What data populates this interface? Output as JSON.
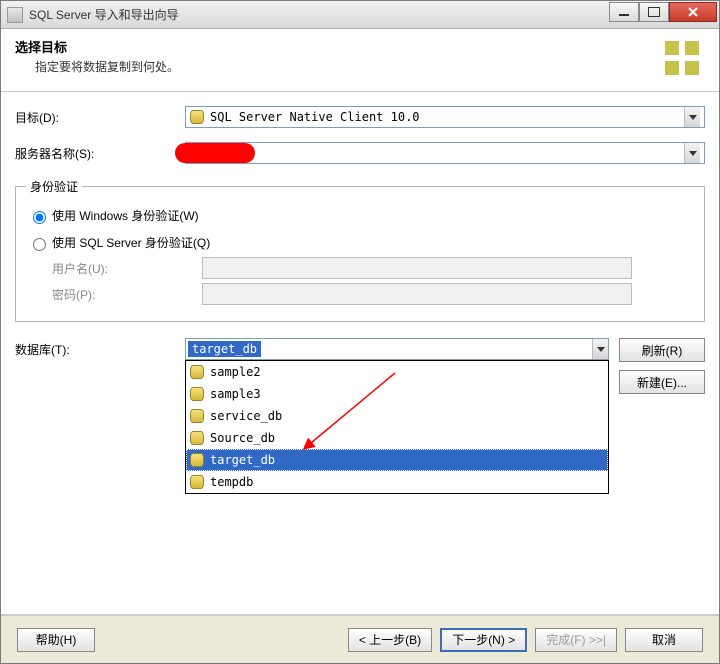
{
  "window": {
    "title": "SQL Server 导入和导出向导"
  },
  "header": {
    "title": "选择目标",
    "subtitle": "指定要将数据复制到何处。"
  },
  "labels": {
    "destination": "目标(D):",
    "server": "服务器名称(S):",
    "auth_legend": "身份验证",
    "auth_windows": "使用 Windows 身份验证(W)",
    "auth_sql": "使用 SQL Server 身份验证(Q)",
    "username": "用户名(U):",
    "password": "密码(P):",
    "database": "数据库(T):"
  },
  "values": {
    "destination": "SQL Server Native Client 10.0",
    "server": "",
    "username": "",
    "password": "",
    "database_selected": "target_db"
  },
  "db_options": [
    "sample2",
    "sample3",
    "service_db",
    "Source_db",
    "target_db",
    "tempdb"
  ],
  "buttons": {
    "refresh": "刷新(R)",
    "new": "新建(E)...",
    "help": "帮助(H)",
    "back": "< 上一步(B)",
    "next": "下一步(N) >",
    "finish": "完成(F) >>|",
    "cancel": "取消"
  }
}
